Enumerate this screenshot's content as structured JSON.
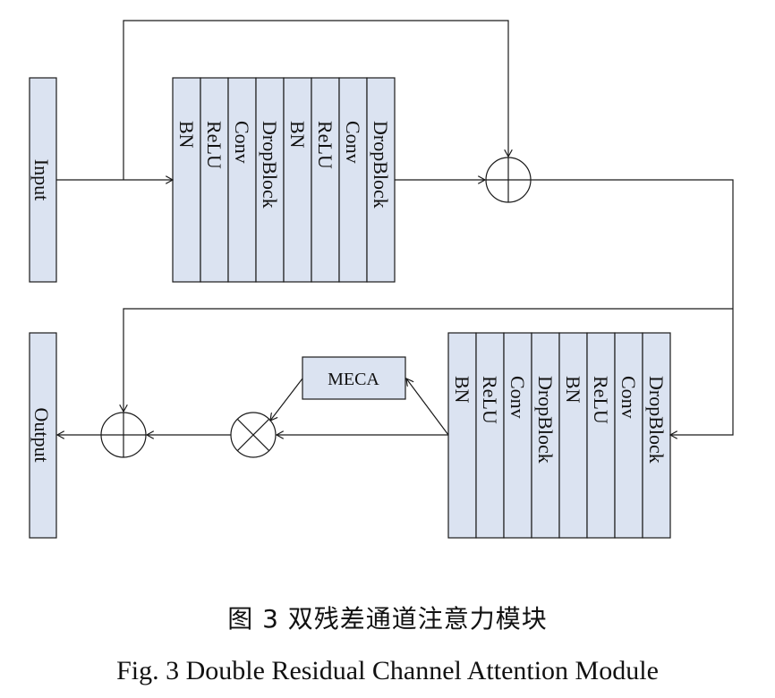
{
  "diagram": {
    "input_label": "Input",
    "output_label": "Output",
    "meca_label": "MECA",
    "block1_layers": [
      "BN",
      "ReLU",
      "Conv",
      "DropBlock",
      "BN",
      "ReLU",
      "Conv",
      "DropBlock"
    ],
    "block2_layers": [
      "BN",
      "ReLU",
      "Conv",
      "DropBlock",
      "BN",
      "ReLU",
      "Conv",
      "DropBlock"
    ]
  },
  "caption": {
    "chinese": "图 3  双残差通道注意力模块",
    "english": "Fig. 3 Double Residual Channel Attention Module"
  }
}
